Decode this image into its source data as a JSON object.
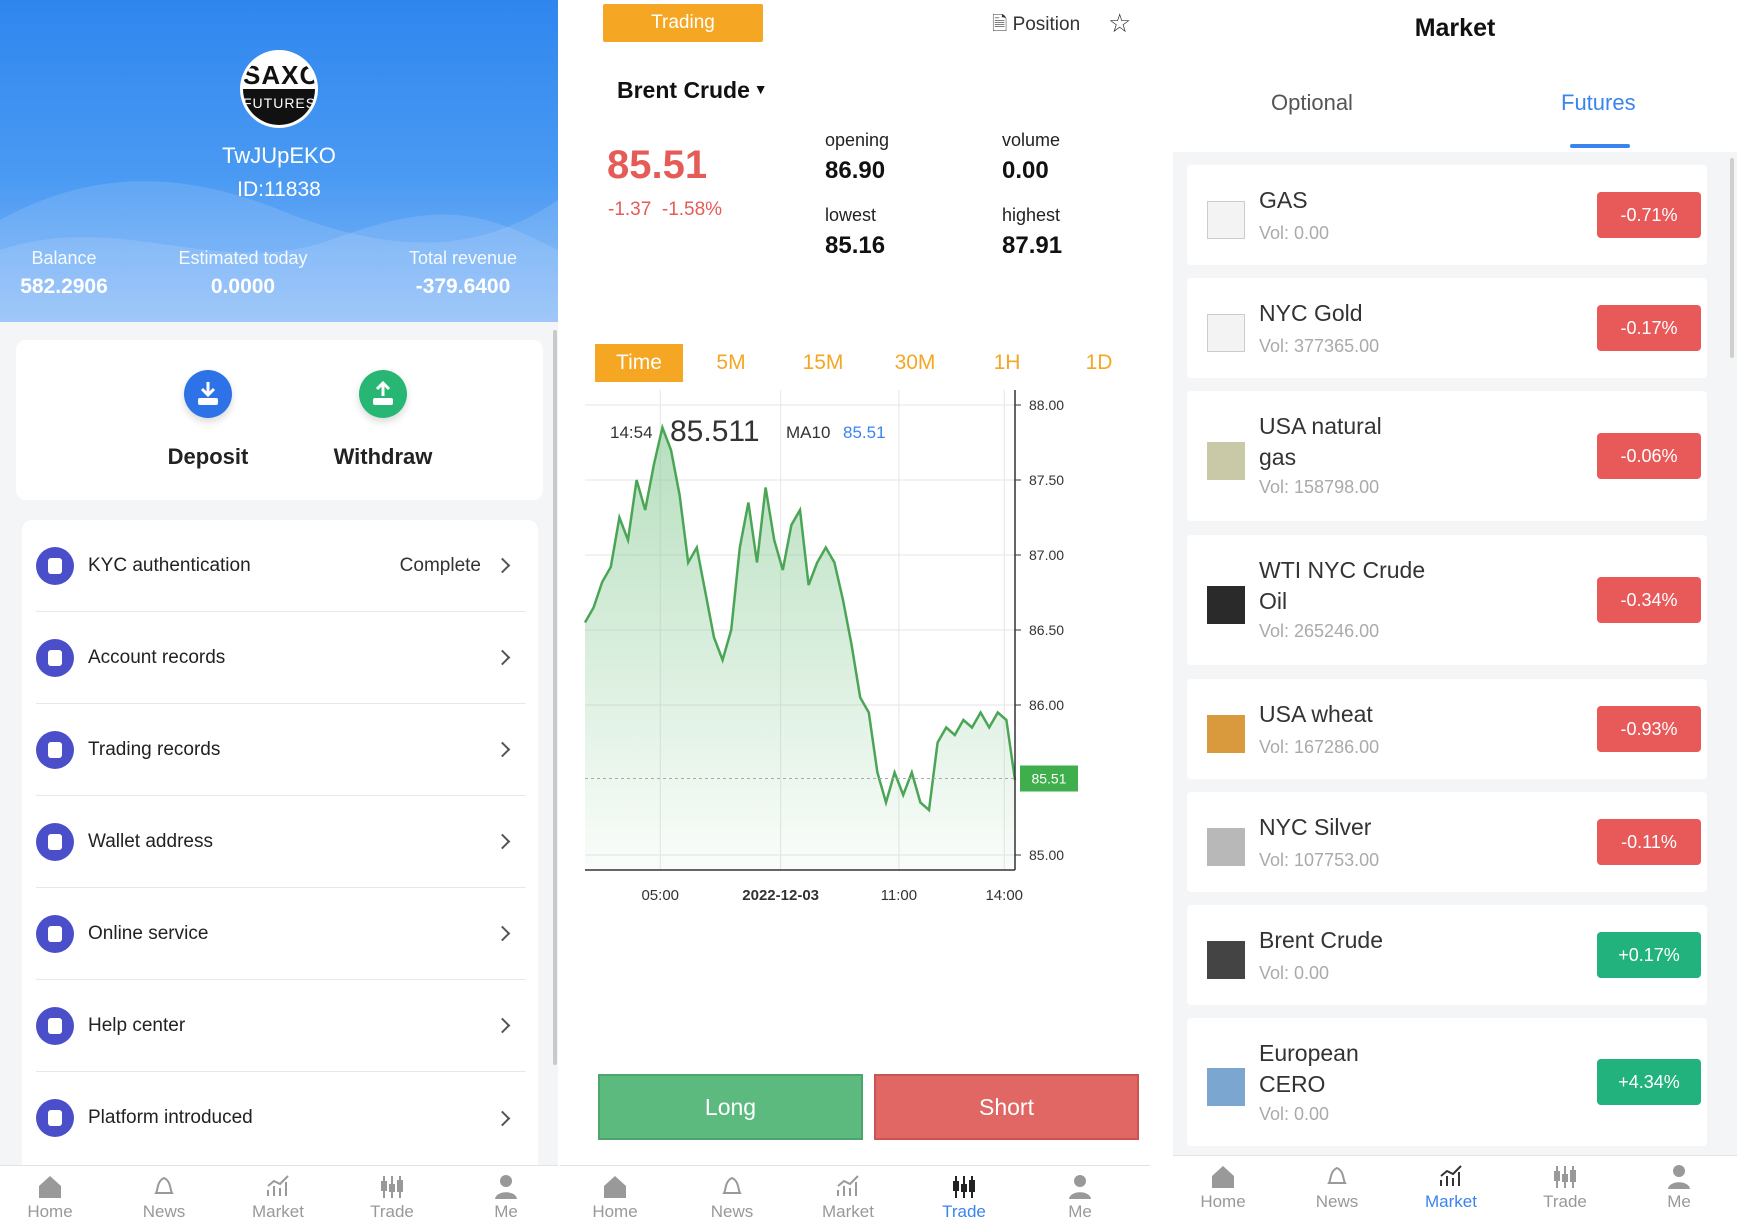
{
  "profile": {
    "logo_top": "SAXO",
    "logo_bottom": "FUTURES",
    "username": "TwJUpEKO",
    "user_id": "ID:11838",
    "stats": [
      {
        "label": "Balance",
        "value": "582.2906"
      },
      {
        "label": "Estimated today",
        "value": "0.0000"
      },
      {
        "label": "Total revenue",
        "value": "-379.6400"
      }
    ],
    "deposit_label": "Deposit",
    "withdraw_label": "Withdraw",
    "menu": [
      {
        "label": "KYC authentication",
        "status": "Complete"
      },
      {
        "label": "Account records",
        "status": ""
      },
      {
        "label": "Trading records",
        "status": ""
      },
      {
        "label": "Wallet address",
        "status": ""
      },
      {
        "label": "Online service",
        "status": ""
      },
      {
        "label": "Help center",
        "status": ""
      },
      {
        "label": "Platform introduced",
        "status": ""
      }
    ]
  },
  "nav": [
    "Home",
    "News",
    "Market",
    "Trade",
    "Me"
  ],
  "trade": {
    "trading_label": "Trading",
    "position_label": "Position",
    "product": "Brent Crude",
    "price": "85.51",
    "change": "-1.37",
    "change_pct": "-1.58%",
    "opening_label": "opening",
    "opening": "86.90",
    "volume_label": "volume",
    "volume": "0.00",
    "lowest_label": "lowest",
    "lowest": "85.16",
    "highest_label": "highest",
    "highest": "87.91",
    "timeframes": [
      "Time",
      "5M",
      "15M",
      "30M",
      "1H",
      "1D"
    ],
    "active_timeframe": "Time",
    "long_label": "Long",
    "short_label": "Short",
    "colors": {
      "up": "#5cba7e",
      "down": "#e06763",
      "accent": "#f5a623",
      "line": "#4aa656"
    }
  },
  "chart_data": {
    "type": "line",
    "title": "",
    "info_time": "14:54",
    "info_price": "85.511",
    "ma_label": "MA10",
    "ma_value": "85.51",
    "current_label": "85.51",
    "current": 85.51,
    "ylim": [
      84.9,
      88.1
    ],
    "yticks": [
      "88.00",
      "87.50",
      "87.00",
      "86.50",
      "86.00",
      "85.00"
    ],
    "ytick_values": [
      88.0,
      87.5,
      87.0,
      86.5,
      86.0,
      85.0
    ],
    "xtick_labels": [
      "05:00",
      "2022-12-03",
      "11:00",
      "14:00"
    ],
    "x": [
      0,
      2,
      4,
      6,
      8,
      10,
      12,
      14,
      16,
      18,
      20,
      22,
      24,
      26,
      28,
      30,
      32,
      34,
      36,
      38,
      40,
      42,
      44,
      46,
      48,
      50,
      52,
      54,
      56,
      58,
      60,
      62,
      64,
      66,
      68,
      70,
      72,
      74,
      76,
      78,
      80,
      82,
      84,
      86,
      88,
      90,
      92,
      94,
      96,
      98,
      100
    ],
    "values": [
      86.55,
      86.65,
      86.82,
      86.92,
      87.25,
      87.1,
      87.5,
      87.3,
      87.6,
      87.85,
      87.7,
      87.4,
      86.95,
      87.05,
      86.75,
      86.45,
      86.3,
      86.5,
      87.05,
      87.35,
      86.95,
      87.45,
      87.1,
      86.9,
      87.2,
      87.3,
      86.8,
      86.95,
      87.05,
      86.95,
      86.7,
      86.4,
      86.05,
      85.95,
      85.55,
      85.35,
      85.55,
      85.4,
      85.55,
      85.35,
      85.3,
      85.75,
      85.85,
      85.8,
      85.9,
      85.85,
      85.95,
      85.85,
      85.95,
      85.9,
      85.5
    ]
  },
  "market": {
    "title": "Market",
    "tabs": [
      "Optional",
      "Futures"
    ],
    "active_tab": "Futures",
    "vol_label": "Vol:",
    "items": [
      {
        "name1": "GAS",
        "name2": "",
        "vol": "0.00",
        "change": "-0.71%",
        "dir": "neg",
        "icon": "broken-image-icon"
      },
      {
        "name1": "NYC Gold",
        "name2": "",
        "vol": "377365.00",
        "change": "-0.17%",
        "dir": "neg",
        "icon": "broken-image-icon"
      },
      {
        "name1": "USA natural",
        "name2": "gas",
        "vol": "158798.00",
        "change": "-0.06%",
        "dir": "neg",
        "icon": "gas-thumbnail-icon"
      },
      {
        "name1": "WTI NYC Crude",
        "name2": "Oil",
        "vol": "265246.00",
        "change": "-0.34%",
        "dir": "neg",
        "icon": "oil-thumbnail-icon"
      },
      {
        "name1": "USA wheat",
        "name2": "",
        "vol": "167286.00",
        "change": "-0.93%",
        "dir": "neg",
        "icon": "wheat-thumbnail-icon"
      },
      {
        "name1": "NYC Silver",
        "name2": "",
        "vol": "107753.00",
        "change": "-0.11%",
        "dir": "neg",
        "icon": "silver-thumbnail-icon"
      },
      {
        "name1": "Brent Crude",
        "name2": "",
        "vol": "0.00",
        "change": "+0.17%",
        "dir": "pos",
        "icon": "brent-thumbnail-icon"
      },
      {
        "name1": "European",
        "name2": "CERO",
        "vol": "0.00",
        "change": "+4.34%",
        "dir": "pos",
        "icon": "cero-thumbnail-icon"
      }
    ]
  }
}
